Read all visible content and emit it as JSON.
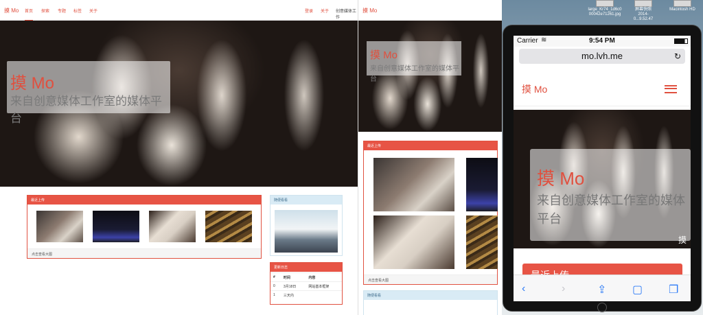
{
  "left": {
    "brand": "摸 Mo",
    "nav": [
      "首页",
      "探索",
      "专题",
      "标签",
      "关于"
    ],
    "nav_right": [
      "登录",
      "关于",
      "创意媒体工作"
    ],
    "hero_title": "摸 Mo",
    "hero_subtitle": "来自创意媒体工作室的媒体平台",
    "recent_title": "最近上传",
    "recent_footer": "点击查看大图",
    "random_title": "随便看看",
    "log_title": "更新日志",
    "log_headers": [
      "#",
      "时间",
      "内容"
    ],
    "log_rows": [
      [
        "0",
        "3月18日",
        "网站基本框架"
      ],
      [
        "1",
        "三天内",
        ""
      ]
    ]
  },
  "middle": {
    "brand": "摸 Mo",
    "hero_title": "摸 Mo",
    "hero_subtitle": "来自创意媒体工作室的媒体平台",
    "recent_title": "最近上传",
    "recent_footer": "点击查看大图",
    "random_title": "随便看看"
  },
  "desktop": {
    "file1_name": "large_Kr74_1d6c0",
    "file1_sub": "00042e71261.jpg",
    "file2_name": "屏幕快照",
    "file2_sub": "2014-0...9.52.47",
    "file3_name": "Macintosh HD"
  },
  "phone": {
    "carrier": "Carrier",
    "time": "9:54 PM",
    "url": "mo.lvh.me",
    "brand": "摸 Mo",
    "hero_title": "摸 Mo",
    "hero_subtitle": "来自创意媒体工作室的媒体平台",
    "button_label": "最近上传",
    "watermark": "摸"
  },
  "colors": {
    "accent": "#e75445",
    "info": "#d9ebf5",
    "ios_blue": "#2f7cf6"
  },
  "icons": [
    "wifi-icon",
    "battery-icon",
    "reload-icon",
    "menu-icon",
    "back-icon",
    "forward-icon",
    "share-icon",
    "bookmarks-icon",
    "tabs-icon"
  ]
}
